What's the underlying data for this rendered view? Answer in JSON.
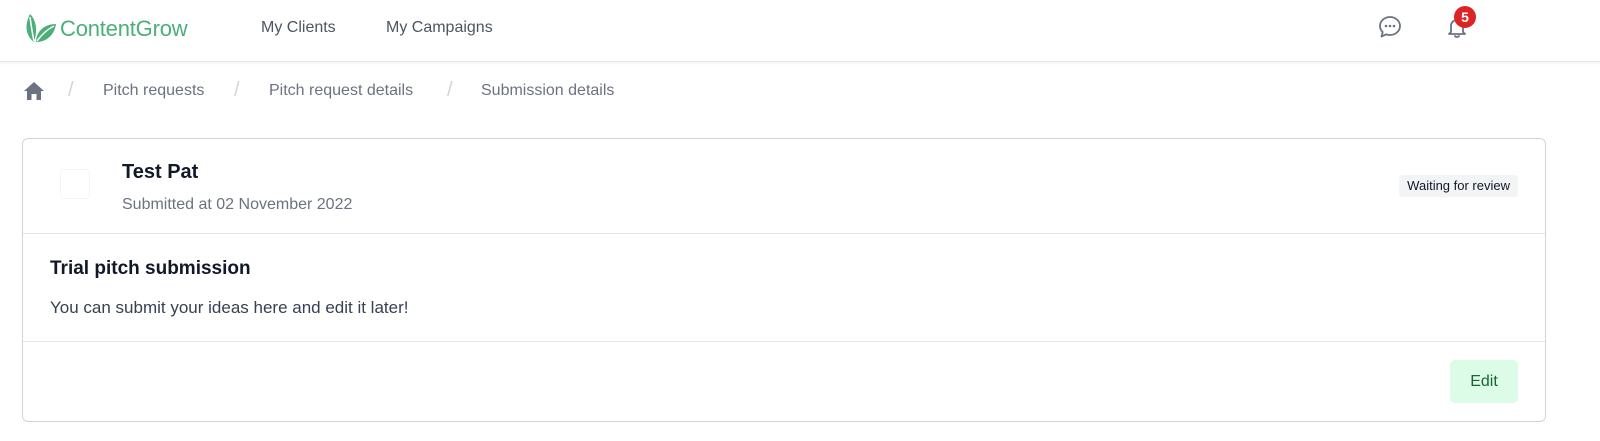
{
  "brand": {
    "name": "ContentGrow",
    "logo_icon": "leaf-logo-icon",
    "color": "#4caf7a"
  },
  "nav": {
    "links": [
      "My Clients",
      "My Campaigns"
    ],
    "icons": [
      "chat-icon",
      "bell-icon"
    ],
    "notification_count": "5"
  },
  "breadcrumb": {
    "home_icon": "home-icon",
    "items": [
      "Pitch requests",
      "Pitch request details",
      "Submission details"
    ]
  },
  "submission": {
    "author": "Test Pat",
    "submitted": "Submitted at 02 November 2022",
    "status": "Waiting for review",
    "title": "Trial pitch submission",
    "body": "You can submit your ideas here and edit it later!",
    "edit_label": "Edit"
  },
  "colors": {
    "badge": "#dc2626",
    "edit_bg": "#dcfce7",
    "edit_text": "#166534"
  }
}
